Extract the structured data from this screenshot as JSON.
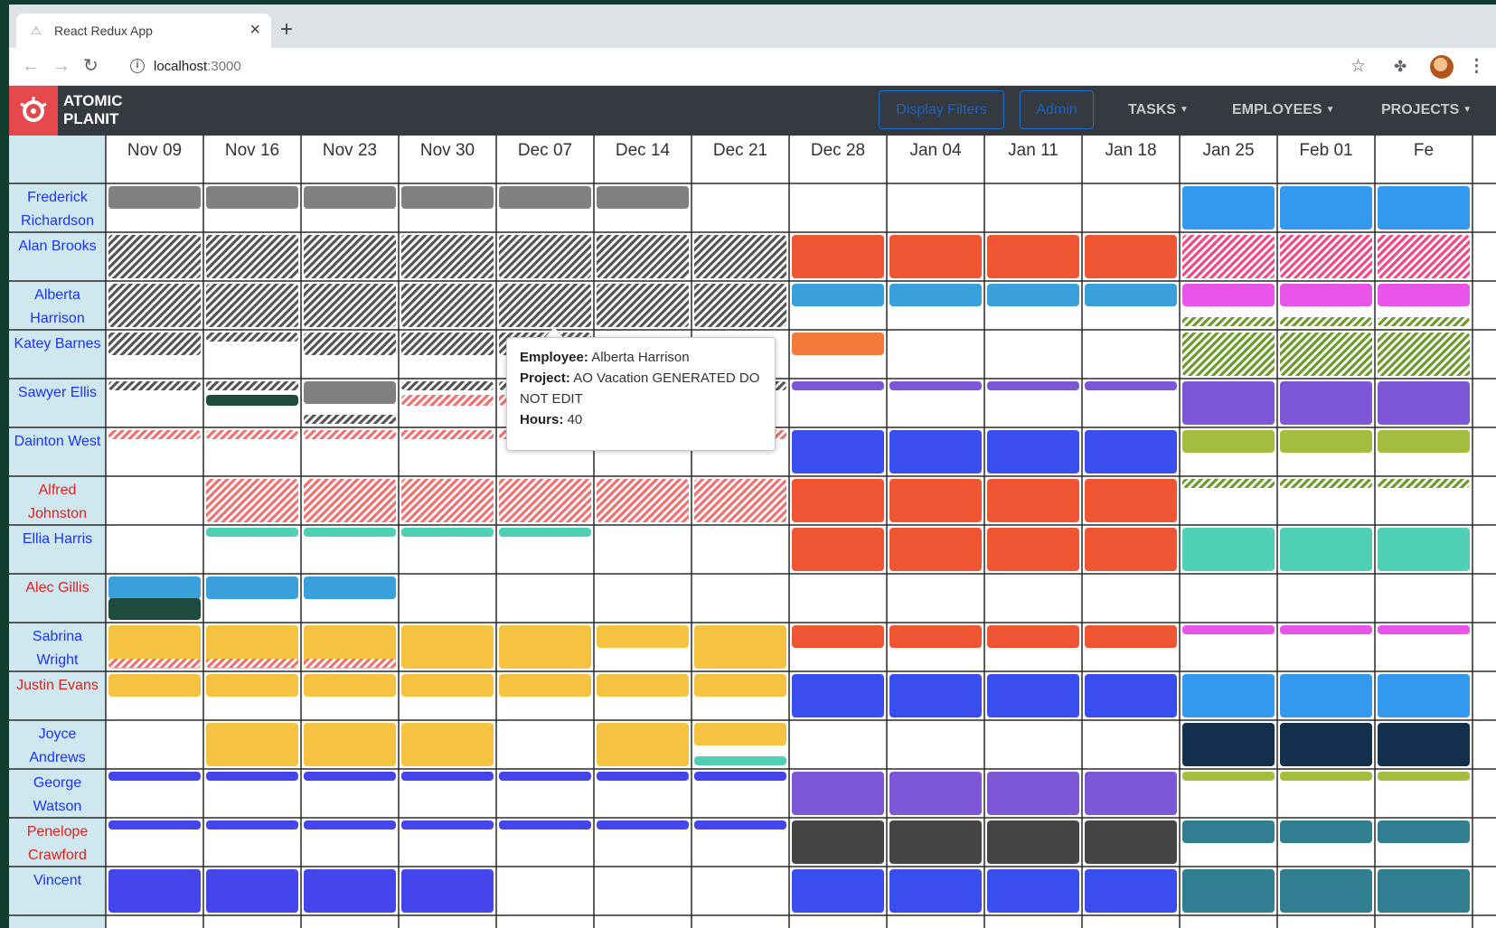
{
  "browser": {
    "tab_title": "React Redux App",
    "tab_close": "×",
    "new_tab": "+",
    "url_host": "localhost",
    "url_port": ":3000"
  },
  "navbar": {
    "brand_line1": "ATOMIC",
    "brand_line2": "PLANIT",
    "display_filters": "Display Filters",
    "admin": "Admin",
    "tasks": "TASKS",
    "employees": "EMPLOYEES",
    "projects": "PROJECTS"
  },
  "schedule": {
    "weeks": [
      "Nov 09",
      "Nov 16",
      "Nov 23",
      "Nov 30",
      "Dec 07",
      "Dec 14",
      "Dec 21",
      "Dec 28",
      "Jan 04",
      "Jan 11",
      "Jan 18",
      "Jan 25",
      "Feb 01",
      "Fe"
    ],
    "colors": {
      "blue_name": "#1a33ff",
      "red_name": "#e02020",
      "gray": "#808080",
      "orange_red": "#f05533",
      "sky": "#3aa0dc",
      "light_blue": "#3399ef",
      "pink_hatch": "#f04880",
      "magenta": "#e855e8",
      "olive_hatch": "#6c9a2a",
      "orange": "#f27a38",
      "purple": "#7e57d6",
      "dark_green": "#1d4b3d",
      "salmon_hatch": "#f07070",
      "royal": "#3a4ef0",
      "yellow_green": "#a5bd3f",
      "teal": "#4fd0b4",
      "yellow": "#f5c242",
      "navy": "#14304f",
      "indigo": "#4545ec",
      "dark_gray": "#454545",
      "dark_teal": "#2f7f91"
    },
    "employees": [
      {
        "name": "Frederick Richardson",
        "lines": [
          "Frederick",
          "Richardson"
        ],
        "color": "blue"
      },
      {
        "name": "Alan Brooks",
        "lines": [
          "Alan Brooks"
        ],
        "color": "blue"
      },
      {
        "name": "Alberta Harrison",
        "lines": [
          "Alberta",
          "Harrison"
        ],
        "color": "blue"
      },
      {
        "name": "Katey Barnes",
        "lines": [
          "Katey Barnes"
        ],
        "color": "blue"
      },
      {
        "name": "Sawyer Ellis",
        "lines": [
          "Sawyer Ellis"
        ],
        "color": "blue"
      },
      {
        "name": "Dainton West",
        "lines": [
          "Dainton West"
        ],
        "color": "blue"
      },
      {
        "name": "Alfred Johnston",
        "lines": [
          "Alfred",
          "Johnston"
        ],
        "color": "red"
      },
      {
        "name": "Ellia Harris",
        "lines": [
          "Ellia Harris"
        ],
        "color": "blue"
      },
      {
        "name": "Alec Gillis",
        "lines": [
          "Alec Gillis"
        ],
        "color": "red"
      },
      {
        "name": "Sabrina Wright",
        "lines": [
          "Sabrina",
          "Wright"
        ],
        "color": "blue"
      },
      {
        "name": "Justin Evans",
        "lines": [
          "Justin Evans"
        ],
        "color": "red"
      },
      {
        "name": "Joyce Andrews",
        "lines": [
          "Joyce",
          "Andrews"
        ],
        "color": "blue"
      },
      {
        "name": "George Watson",
        "lines": [
          "George",
          "Watson"
        ],
        "color": "blue"
      },
      {
        "name": "Penelope Crawford",
        "lines": [
          "Penelope",
          "Crawford"
        ],
        "color": "red"
      },
      {
        "name": "Vincent",
        "lines": [
          "Vincent"
        ],
        "color": "blue"
      }
    ],
    "assignments": [
      {
        "row": 0,
        "from": 0,
        "to": 5,
        "color": "gray",
        "pattern": "solid",
        "size": "top"
      },
      {
        "row": 0,
        "from": 11,
        "to": 13,
        "color": "light_blue",
        "pattern": "solid",
        "size": "full"
      },
      {
        "row": 1,
        "from": 0,
        "to": 6,
        "color": "gray",
        "pattern": "hatch",
        "size": "full"
      },
      {
        "row": 1,
        "from": 7,
        "to": 10,
        "color": "orange_red",
        "pattern": "solid",
        "size": "full"
      },
      {
        "row": 1,
        "from": 11,
        "to": 13,
        "color": "pink_hatch",
        "pattern": "hatch",
        "size": "full"
      },
      {
        "row": 2,
        "from": 0,
        "to": 6,
        "color": "gray",
        "pattern": "hatch",
        "size": "full"
      },
      {
        "row": 2,
        "from": 7,
        "to": 10,
        "color": "sky",
        "pattern": "solid",
        "size": "top"
      },
      {
        "row": 2,
        "from": 11,
        "to": 13,
        "color": "magenta",
        "pattern": "solid",
        "size": "top"
      },
      {
        "row": 2,
        "from": 11,
        "to": 13,
        "color": "olive_hatch",
        "pattern": "hatch",
        "size": "strip_bottom"
      },
      {
        "row": 3,
        "from": 0,
        "to": 0,
        "color": "gray",
        "pattern": "hatch",
        "size": "top"
      },
      {
        "row": 3,
        "from": 1,
        "to": 1,
        "color": "gray",
        "pattern": "hatch",
        "size": "strip_top"
      },
      {
        "row": 3,
        "from": 2,
        "to": 4,
        "color": "gray",
        "pattern": "hatch",
        "size": "top"
      },
      {
        "row": 3,
        "from": 7,
        "to": 7,
        "color": "orange",
        "pattern": "solid",
        "size": "top"
      },
      {
        "row": 3,
        "from": 11,
        "to": 13,
        "color": "olive_hatch",
        "pattern": "hatch",
        "size": "full"
      },
      {
        "row": 4,
        "from": 0,
        "to": 0,
        "color": "gray",
        "pattern": "hatch",
        "size": "strip_top"
      },
      {
        "row": 4,
        "from": 1,
        "to": 1,
        "color": "gray",
        "pattern": "hatch",
        "size": "strip_top"
      },
      {
        "row": 4,
        "from": 1,
        "to": 1,
        "color": "dark_green",
        "pattern": "solid",
        "size": "strip_mid"
      },
      {
        "row": 4,
        "from": 2,
        "to": 2,
        "color": "gray",
        "pattern": "solid",
        "size": "top"
      },
      {
        "row": 4,
        "from": 2,
        "to": 2,
        "color": "gray",
        "pattern": "hatch",
        "size": "strip_bottom"
      },
      {
        "row": 4,
        "from": 3,
        "to": 4,
        "color": "gray",
        "pattern": "hatch",
        "size": "strip_top"
      },
      {
        "row": 4,
        "from": 3,
        "to": 4,
        "color": "salmon_hatch",
        "pattern": "hatch",
        "size": "strip_mid"
      },
      {
        "row": 4,
        "from": 6,
        "to": 6,
        "color": "gray",
        "pattern": "hatch",
        "size": "strip_top"
      },
      {
        "row": 4,
        "from": 7,
        "to": 10,
        "color": "purple",
        "pattern": "solid",
        "size": "strip_top"
      },
      {
        "row": 4,
        "from": 11,
        "to": 13,
        "color": "purple",
        "pattern": "solid",
        "size": "full"
      },
      {
        "row": 5,
        "from": 0,
        "to": 6,
        "color": "salmon_hatch",
        "pattern": "hatch",
        "size": "strip_top"
      },
      {
        "row": 5,
        "from": 7,
        "to": 10,
        "color": "royal",
        "pattern": "solid",
        "size": "full"
      },
      {
        "row": 5,
        "from": 11,
        "to": 13,
        "color": "yellow_green",
        "pattern": "solid",
        "size": "top"
      },
      {
        "row": 6,
        "from": 1,
        "to": 6,
        "color": "salmon_hatch",
        "pattern": "hatch",
        "size": "full"
      },
      {
        "row": 6,
        "from": 7,
        "to": 10,
        "color": "orange_red",
        "pattern": "solid",
        "size": "full"
      },
      {
        "row": 6,
        "from": 11,
        "to": 13,
        "color": "olive_hatch",
        "pattern": "hatch",
        "size": "strip_top"
      },
      {
        "row": 7,
        "from": 1,
        "to": 4,
        "color": "teal",
        "pattern": "solid",
        "size": "strip_top"
      },
      {
        "row": 7,
        "from": 7,
        "to": 10,
        "color": "orange_red",
        "pattern": "solid",
        "size": "full"
      },
      {
        "row": 7,
        "from": 11,
        "to": 13,
        "color": "teal",
        "pattern": "solid",
        "size": "full"
      },
      {
        "row": 8,
        "from": 0,
        "to": 2,
        "color": "sky",
        "pattern": "solid",
        "size": "top"
      },
      {
        "row": 8,
        "from": 0,
        "to": 0,
        "color": "dark_green",
        "pattern": "solid",
        "size": "bottom"
      },
      {
        "row": 9,
        "from": 0,
        "to": 4,
        "color": "yellow",
        "pattern": "solid",
        "size": "full"
      },
      {
        "row": 9,
        "from": 0,
        "to": 2,
        "color": "salmon_hatch",
        "pattern": "hatch",
        "size": "strip_bottom"
      },
      {
        "row": 9,
        "from": 5,
        "to": 5,
        "color": "yellow",
        "pattern": "solid",
        "size": "top"
      },
      {
        "row": 9,
        "from": 6,
        "to": 6,
        "color": "yellow",
        "pattern": "solid",
        "size": "full"
      },
      {
        "row": 9,
        "from": 7,
        "to": 10,
        "color": "orange_red",
        "pattern": "solid",
        "size": "top"
      },
      {
        "row": 9,
        "from": 11,
        "to": 13,
        "color": "magenta",
        "pattern": "solid",
        "size": "strip_top"
      },
      {
        "row": 10,
        "from": 0,
        "to": 6,
        "color": "yellow",
        "pattern": "solid",
        "size": "top"
      },
      {
        "row": 10,
        "from": 7,
        "to": 10,
        "color": "royal",
        "pattern": "solid",
        "size": "full"
      },
      {
        "row": 10,
        "from": 11,
        "to": 13,
        "color": "light_blue",
        "pattern": "solid",
        "size": "full"
      },
      {
        "row": 11,
        "from": 1,
        "to": 3,
        "color": "yellow",
        "pattern": "solid",
        "size": "full"
      },
      {
        "row": 11,
        "from": 5,
        "to": 5,
        "color": "yellow",
        "pattern": "solid",
        "size": "full"
      },
      {
        "row": 11,
        "from": 6,
        "to": 6,
        "color": "yellow",
        "pattern": "solid",
        "size": "top"
      },
      {
        "row": 11,
        "from": 6,
        "to": 6,
        "color": "teal",
        "pattern": "solid",
        "size": "strip_bottom"
      },
      {
        "row": 11,
        "from": 11,
        "to": 13,
        "color": "navy",
        "pattern": "solid",
        "size": "full"
      },
      {
        "row": 12,
        "from": 0,
        "to": 6,
        "color": "indigo",
        "pattern": "solid",
        "size": "strip_top"
      },
      {
        "row": 12,
        "from": 7,
        "to": 10,
        "color": "purple",
        "pattern": "solid",
        "size": "full"
      },
      {
        "row": 12,
        "from": 11,
        "to": 13,
        "color": "yellow_green",
        "pattern": "solid",
        "size": "strip_top"
      },
      {
        "row": 13,
        "from": 0,
        "to": 6,
        "color": "indigo",
        "pattern": "solid",
        "size": "strip_top"
      },
      {
        "row": 13,
        "from": 7,
        "to": 10,
        "color": "dark_gray",
        "pattern": "solid",
        "size": "full"
      },
      {
        "row": 13,
        "from": 11,
        "to": 13,
        "color": "dark_teal",
        "pattern": "solid",
        "size": "top"
      },
      {
        "row": 14,
        "from": 0,
        "to": 3,
        "color": "indigo",
        "pattern": "solid",
        "size": "full"
      },
      {
        "row": 14,
        "from": 7,
        "to": 10,
        "color": "royal",
        "pattern": "solid",
        "size": "full"
      },
      {
        "row": 14,
        "from": 11,
        "to": 13,
        "color": "dark_teal",
        "pattern": "solid",
        "size": "full"
      }
    ]
  },
  "tooltip": {
    "employee_label": "Employee:",
    "employee_value": "Alberta Harrison",
    "project_label": "Project:",
    "project_value": "AO Vacation GENERATED DO NOT EDIT",
    "hours_label": "Hours:",
    "hours_value": "40"
  }
}
